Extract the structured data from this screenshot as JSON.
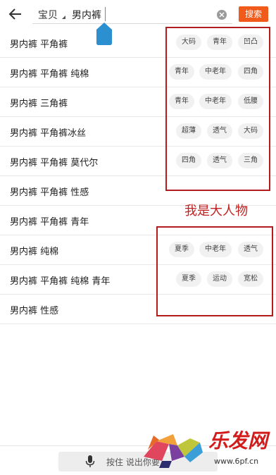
{
  "topbar": {
    "scope_label": "宝贝",
    "query": "男内裤",
    "search_label": "搜索"
  },
  "suggestions": [
    {
      "text": "男内裤 平角裤",
      "tags": [
        "大码",
        "青年",
        "凹凸"
      ]
    },
    {
      "text": "男内裤 平角裤 纯棉",
      "tags": [
        "青年",
        "中老年",
        "四角"
      ]
    },
    {
      "text": "男内裤 三角裤",
      "tags": [
        "青年",
        "中老年",
        "低腰"
      ]
    },
    {
      "text": "男内裤 平角裤冰丝",
      "tags": [
        "超薄",
        "透气",
        "大码"
      ]
    },
    {
      "text": "男内裤 平角裤 莫代尔",
      "tags": [
        "四角",
        "透气",
        "三角"
      ]
    },
    {
      "text": "男内裤 平角裤 性感",
      "tags": []
    },
    {
      "text": "男内裤 平角裤 青年",
      "tags": []
    },
    {
      "text": "男内裤 纯棉",
      "tags": [
        "夏季",
        "中老年",
        "透气"
      ]
    },
    {
      "text": "男内裤 平角裤 纯棉 青年",
      "tags": [
        "夏季",
        "运动",
        "宽松"
      ]
    },
    {
      "text": "男内裤 性感",
      "tags": []
    }
  ],
  "annotation": {
    "text": "我是大人物",
    "color": "#c02020"
  },
  "bottom": {
    "voice_label": "按住 说出你要"
  },
  "watermark": {
    "brand": "乐发网",
    "url": "www.6pf.cn"
  },
  "colors": {
    "accent": "#f05a1a",
    "annotation": "#b21c1c",
    "tag_bg": "#f1f1f1"
  }
}
